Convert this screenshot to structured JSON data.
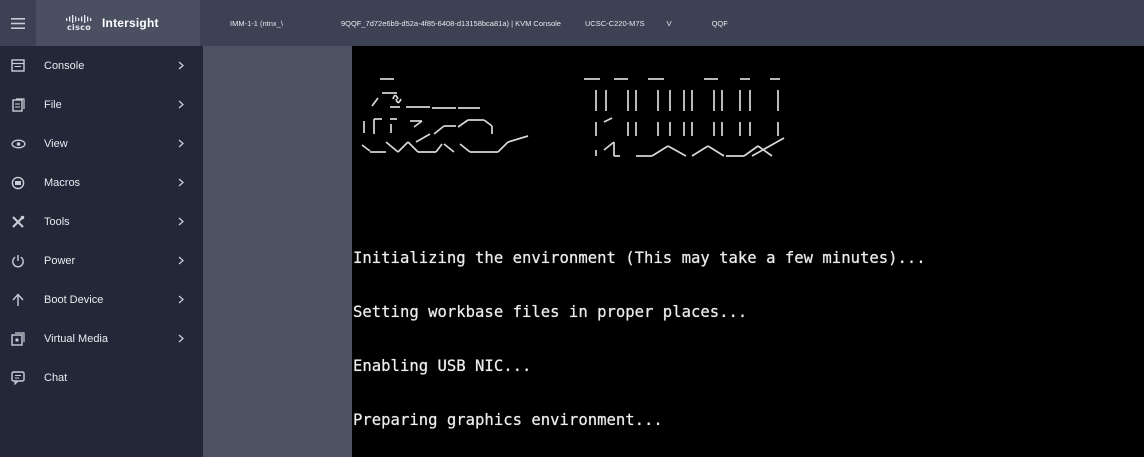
{
  "topbar": {
    "menu_icon": "hamburger-icon",
    "brand": {
      "logo_word": "cisco",
      "product": "Intersight"
    },
    "session": {
      "server_prefix": "IMM-1-1 (ntnx_\\",
      "server_suffix": "9QQF_7d72e6b9-d52a-4f85-6408-d13158bca81a) | KVM Console",
      "model": "UCSC-C220-M7S",
      "serial_prefix": "V",
      "serial_suffix": "QQF"
    }
  },
  "sidebar": {
    "items": [
      {
        "label": "Console",
        "icon": "console-icon",
        "has_submenu": true
      },
      {
        "label": "File",
        "icon": "file-icon",
        "has_submenu": true
      },
      {
        "label": "View",
        "icon": "eye-icon",
        "has_submenu": true
      },
      {
        "label": "Macros",
        "icon": "keyboard-icon",
        "has_submenu": true
      },
      {
        "label": "Tools",
        "icon": "tools-icon",
        "has_submenu": true
      },
      {
        "label": "Power",
        "icon": "power-icon",
        "has_submenu": true
      },
      {
        "label": "Boot Device",
        "icon": "arrow-up-icon",
        "has_submenu": true
      },
      {
        "label": "Virtual Media",
        "icon": "virtual-media-icon",
        "has_submenu": true
      },
      {
        "label": "Chat",
        "icon": "chat-icon",
        "has_submenu": false
      }
    ]
  },
  "console": {
    "banner": "CiscoKVM",
    "lines": [
      "Initializing the environment (This may take a few minutes)...",
      "Setting workbase files in proper places...",
      "Enabling USB NIC...",
      "Preparing graphics environment..."
    ]
  },
  "colors": {
    "topbar": "#3c4153",
    "brand_block": "#4a5061",
    "sidebar": "#232838",
    "gap_panel": "#4d5263",
    "console_bg": "#000000",
    "console_text": "#ececec"
  }
}
